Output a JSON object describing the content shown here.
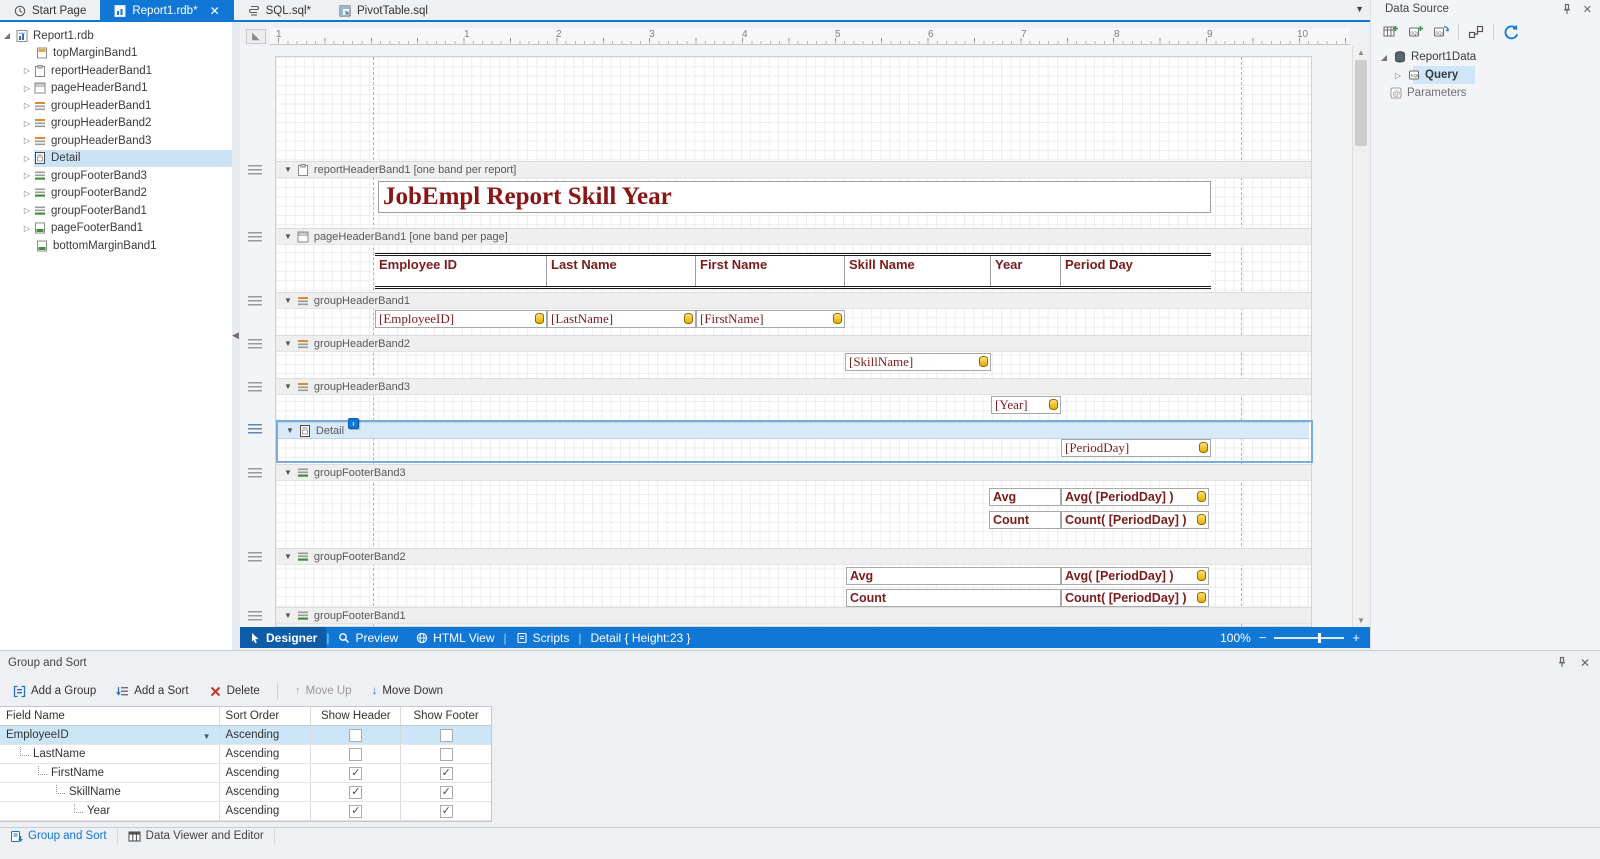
{
  "colors": {
    "accent": "#1177d7",
    "field_text": "#7b1c1c",
    "selection": "#cde6f7",
    "status_bar": "#1177d7"
  },
  "tabs": {
    "items": [
      {
        "label": "Start Page"
      },
      {
        "label": "Report1.rdb*"
      },
      {
        "label": "SQL.sql*"
      },
      {
        "label": "PivotTable.sql"
      }
    ]
  },
  "sidebar": {
    "items": [
      {
        "label": "Report1.rdb"
      },
      {
        "label": "topMarginBand1"
      },
      {
        "label": "reportHeaderBand1"
      },
      {
        "label": "pageHeaderBand1"
      },
      {
        "label": "groupHeaderBand1"
      },
      {
        "label": "groupHeaderBand2"
      },
      {
        "label": "groupHeaderBand3"
      },
      {
        "label": "Detail"
      },
      {
        "label": "groupFooterBand3"
      },
      {
        "label": "groupFooterBand2"
      },
      {
        "label": "groupFooterBand1"
      },
      {
        "label": "pageFooterBand1"
      },
      {
        "label": "bottomMarginBand1"
      }
    ]
  },
  "designer": {
    "ruler_labels": [
      "1",
      "1",
      "2",
      "3",
      "4",
      "5",
      "6",
      "7",
      "8",
      "9",
      "10"
    ],
    "bands": {
      "report_header": {
        "label": "reportHeaderBand1 [one band per report]",
        "title": "JobEmpl Report Skill Year"
      },
      "page_header": {
        "label": "pageHeaderBand1 [one band per page]",
        "columns": [
          "Employee ID",
          "Last Name",
          "First Name",
          "Skill Name",
          "Year",
          "Period Day"
        ]
      },
      "group_header1": {
        "label": "groupHeaderBand1",
        "fields": [
          "[EmployeeID]",
          "[LastName]",
          "[FirstName]"
        ]
      },
      "group_header2": {
        "label": "groupHeaderBand2",
        "field": "[SkillName]"
      },
      "group_header3": {
        "label": "groupHeaderBand3",
        "field": "[Year]"
      },
      "detail": {
        "label": "Detail",
        "field": "[PeriodDay]"
      },
      "group_footer3": {
        "label": "groupFooterBand3",
        "avg_label": "Avg",
        "avg_expr": "Avg( [PeriodDay] )",
        "count_label": "Count",
        "count_expr": "Count( [PeriodDay] )"
      },
      "group_footer2": {
        "label": "groupFooterBand2",
        "avg_label": "Avg",
        "avg_expr": "Avg( [PeriodDay] )",
        "count_label": "Count",
        "count_expr": "Count( [PeriodDay] )"
      },
      "group_footer1": {
        "label": "groupFooterBand1"
      }
    },
    "status": {
      "views": [
        "Designer",
        "Preview",
        "HTML View",
        "Scripts"
      ],
      "selection_info": "Detail { Height:23 }",
      "zoom": "100%"
    }
  },
  "data_source": {
    "title": "Data Source",
    "tree": [
      {
        "label": "Report1Data"
      },
      {
        "label": "Query"
      },
      {
        "label": "Parameters"
      }
    ]
  },
  "group_sort": {
    "title": "Group and Sort",
    "toolbar": {
      "add_group": "Add a Group",
      "add_sort": "Add a Sort",
      "delete": "Delete",
      "move_up": "Move Up",
      "move_down": "Move Down"
    },
    "table": {
      "headers": [
        "Field Name",
        "Sort Order",
        "Show Header",
        "Show Footer"
      ],
      "rows": [
        {
          "field": "EmployeeID",
          "sort": "Ascending",
          "show_header": false,
          "show_footer": false
        },
        {
          "field": "LastName",
          "sort": "Ascending",
          "show_header": false,
          "show_footer": false
        },
        {
          "field": "FirstName",
          "sort": "Ascending",
          "show_header": true,
          "show_footer": true
        },
        {
          "field": "SkillName",
          "sort": "Ascending",
          "show_header": true,
          "show_footer": true
        },
        {
          "field": "Year",
          "sort": "Ascending",
          "show_header": true,
          "show_footer": true
        }
      ]
    },
    "tabs": [
      "Group and Sort",
      "Data Viewer and Editor"
    ]
  }
}
